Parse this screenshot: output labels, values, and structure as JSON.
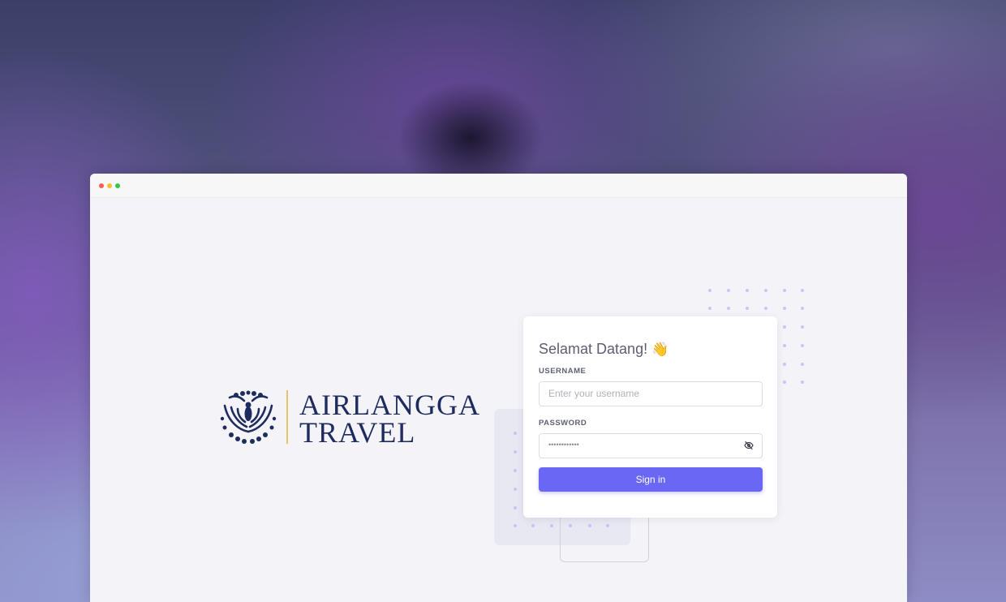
{
  "window": {
    "controls": [
      "close",
      "minimize",
      "maximize"
    ]
  },
  "brand": {
    "line1": "AIRLANGGA",
    "line2": "TRAVEL",
    "colors": {
      "navy": "#1e2b5e",
      "gold": "#e3c26a"
    }
  },
  "login": {
    "title": "Selamat Datang!",
    "title_emoji": "👋",
    "username_label": "USERNAME",
    "username_placeholder": "Enter your username",
    "username_value": "",
    "password_label": "PASSWORD",
    "password_value_masked": "••••••••••••",
    "signin_label": "Sign in",
    "accent_color": "#6a67f5"
  },
  "icons": {
    "password_toggle": "eye-off-icon",
    "logo": "phoenix-emblem-icon"
  }
}
